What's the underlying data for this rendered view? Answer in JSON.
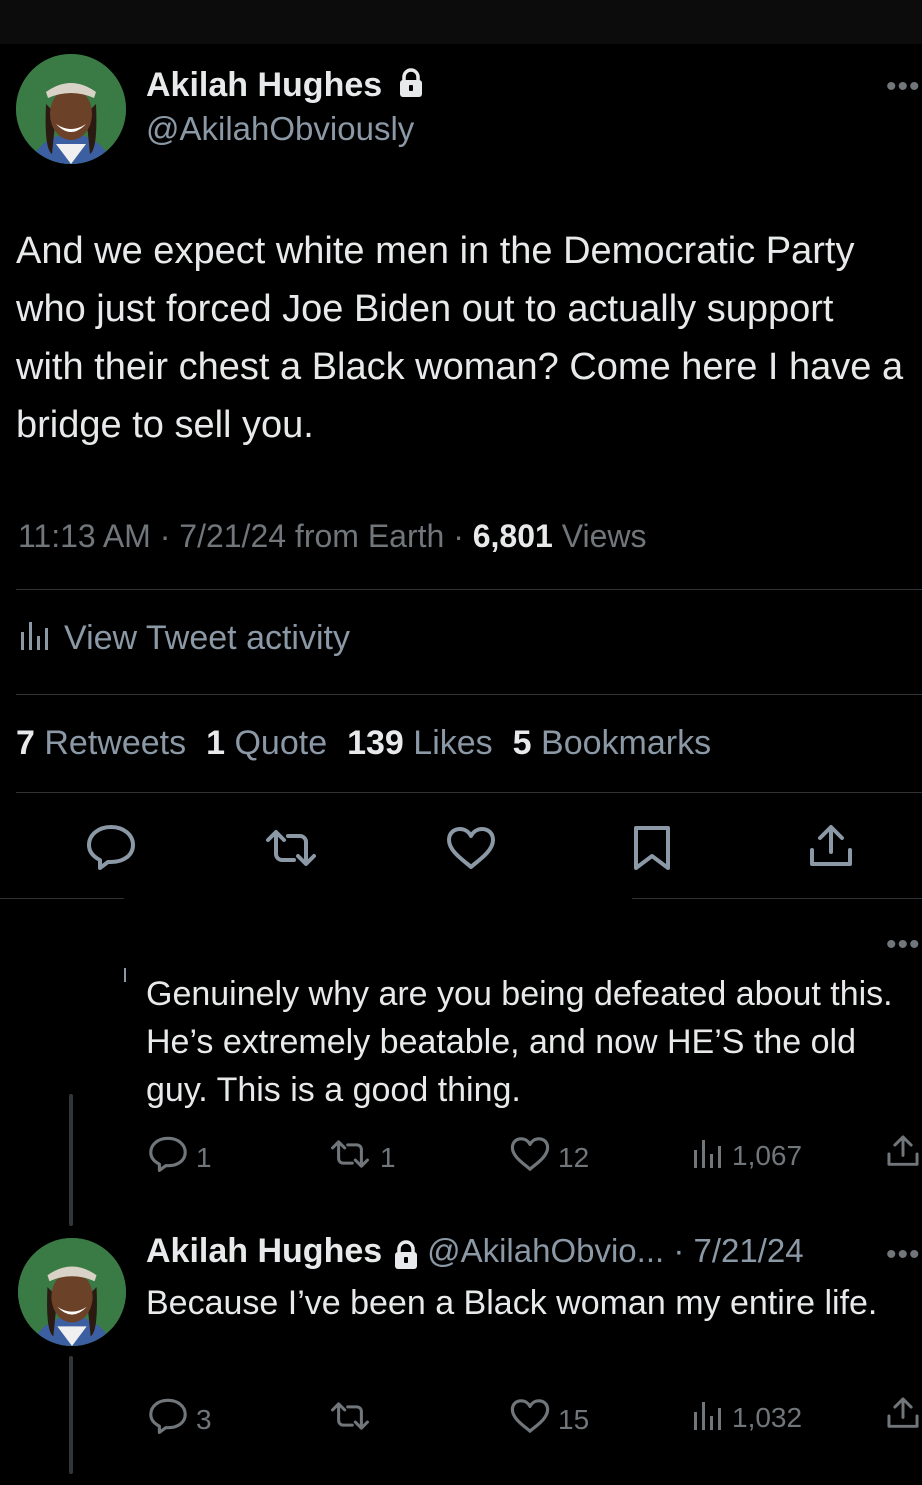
{
  "tweet": {
    "author_name": "Akilah Hughes",
    "author_handle": "@AkilahObviously",
    "text": "And we expect white men in the Democratic Party who just forced Joe Biden out to actually support with their chest a Black woman? Come here I have a bridge to sell you.",
    "time": "11:13 AM",
    "date": "7/21/24",
    "source": "from Earth",
    "views_count": "6,801",
    "views_label": "Views",
    "activity_label": "View Tweet activity",
    "retweets_count": "7",
    "retweets_label": "Retweets",
    "quotes_count": "1",
    "quotes_label": "Quote",
    "likes_count": "139",
    "likes_label": "Likes",
    "bookmarks_count": "5",
    "bookmarks_label": "Bookmarks"
  },
  "reply1": {
    "text": "Genuinely why are you being defeated about this. He’s extremely beatable, and now HE’S the old guy. This is a good thing.",
    "replies": "1",
    "retweets": "1",
    "likes": "12",
    "views": "1,067"
  },
  "reply2": {
    "author_name": "Akilah Hughes",
    "author_handle": "@AkilahObvio...",
    "date": "7/21/24",
    "text": "Because I’ve been a Black woman my entire life.",
    "replies": "3",
    "likes": "15",
    "views": "1,032"
  },
  "icons": {
    "lock": "lock-icon",
    "more": "more-icon",
    "reply": "reply-icon",
    "retweet": "retweet-icon",
    "like": "heart-icon",
    "bookmark": "bookmark-icon",
    "share": "share-icon",
    "analytics": "analytics-icon"
  },
  "colors": {
    "background": "#000000",
    "text": "#e7e9ea",
    "secondary": "#71767b",
    "divider": "#2f3336"
  }
}
